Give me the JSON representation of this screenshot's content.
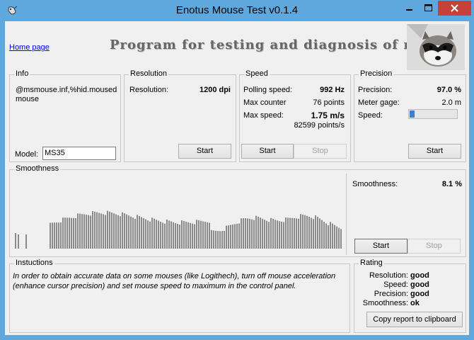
{
  "window": {
    "title": "Enotus Mouse Test v0.1.4",
    "min_icon": "minimize-icon",
    "max_icon": "maximize-icon",
    "close_icon": "close-icon",
    "close_color": "#c7413b",
    "titlebar_color": "#5fa8dd"
  },
  "header": {
    "home_link": "Home page",
    "heading": "Program for testing and diagnosis of mice"
  },
  "info": {
    "label": "Info",
    "device": "@msmouse.inf,%hid.moused mouse",
    "model_label": "Model:",
    "model_value": "MS35"
  },
  "resolution": {
    "label": "Resolution",
    "field_label": "Resolution:",
    "field_value": "1200 dpi",
    "start": "Start"
  },
  "speed": {
    "label": "Speed",
    "polling_label": "Polling speed:",
    "polling_value": "992 Hz",
    "counter_label": "Max counter",
    "counter_value": "76 points",
    "max_label": "Max  speed:",
    "max_value": "1.75 m/s",
    "max_points": "82599 points/s",
    "start": "Start",
    "stop": "Stop"
  },
  "precision": {
    "label": "Precision",
    "precision_label": "Precision:",
    "precision_value": "97.0 %",
    "meter_label": "Meter gage:",
    "meter_value": "2.0 m",
    "speed_label": "Speed:",
    "speed_level": 0.1,
    "start": "Start"
  },
  "smoothness": {
    "label": "Smoothness",
    "field_label": "Smoothness:",
    "field_value": "8.1 %",
    "start": "Start",
    "stop": "Stop"
  },
  "instructions": {
    "label": "Instuctions",
    "text": "In order to obtain accurate data on some mouses (like Logithech), turn off mouse acceleration (enhance cursor precision) and set mouse speed to maximum in the control panel."
  },
  "rating": {
    "label": "Rating",
    "rows": [
      {
        "label": "Resolution:",
        "value": "good"
      },
      {
        "label": "Speed:",
        "value": "good"
      },
      {
        "label": "Precision:",
        "value": "good"
      },
      {
        "label": "Smoothness:",
        "value": "ok"
      }
    ],
    "copy": "Copy report to clipboard"
  }
}
